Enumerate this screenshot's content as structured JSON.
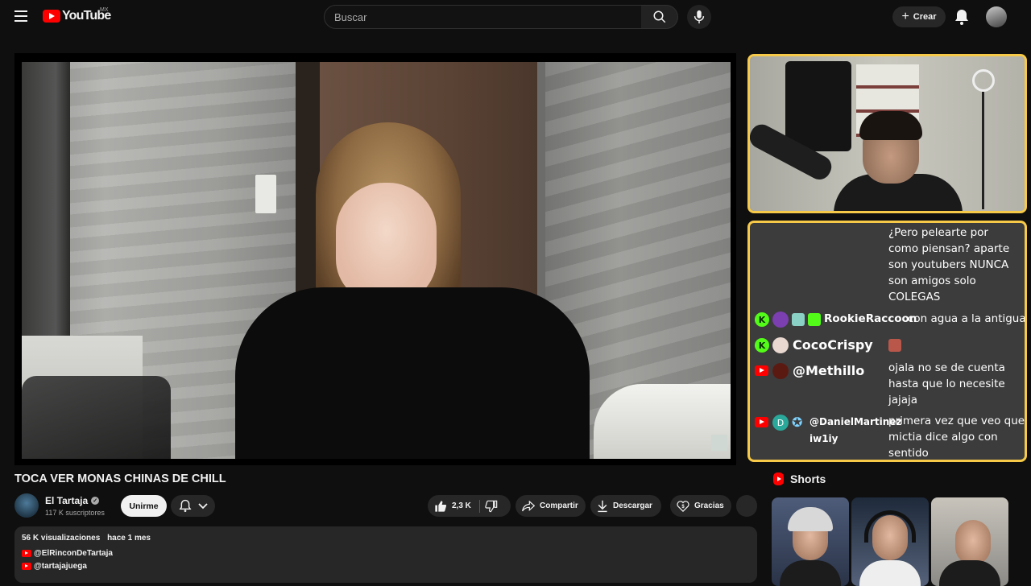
{
  "header": {
    "logo_text": "YouTube",
    "region": "MX",
    "search_placeholder": "Buscar",
    "create_label": "Crear"
  },
  "video": {
    "title": "TOCA VER MONAS CHINAS DE CHILL"
  },
  "channel": {
    "name": "El Tartaja",
    "subscribers": "117 K suscriptores",
    "join_label": "Unirme"
  },
  "actions": {
    "likes": "2,3 K",
    "share_label": "Compartir",
    "download_label": "Descargar",
    "thanks_label": "Gracias"
  },
  "description": {
    "views": "56 K visualizaciones",
    "date": "hace 1 mes",
    "links": [
      "@ElRinconDeTartaja",
      "@tartajajuega"
    ]
  },
  "stream_chat": {
    "top_message_lines": [
      "¿Pero pelearte por",
      "como piensan? aparte",
      "son youtubers NUNCA",
      "son amigos solo",
      "COLEGAS"
    ],
    "messages": [
      {
        "platform": "kick",
        "user": "RookieRaccoon",
        "text_lines": [
          "con agua a la antigua"
        ]
      },
      {
        "platform": "kick",
        "user": "CocoCrispy",
        "text_lines": []
      },
      {
        "platform": "youtube",
        "user": "@Methillo",
        "text_lines": [
          "ojala no se de cuenta",
          "hasta que lo necesite",
          "jajaja"
        ]
      },
      {
        "platform": "youtube",
        "user_lines": [
          "@DanielMartinez",
          "iw1iy"
        ],
        "text_lines": [
          "primera vez que veo que",
          "mictia dice algo con",
          "sentido"
        ]
      }
    ],
    "colors": {
      "kick": "#53fc18",
      "youtube": "#ff0000",
      "border": "#f7c948"
    }
  },
  "shorts": {
    "title": "Shorts"
  }
}
